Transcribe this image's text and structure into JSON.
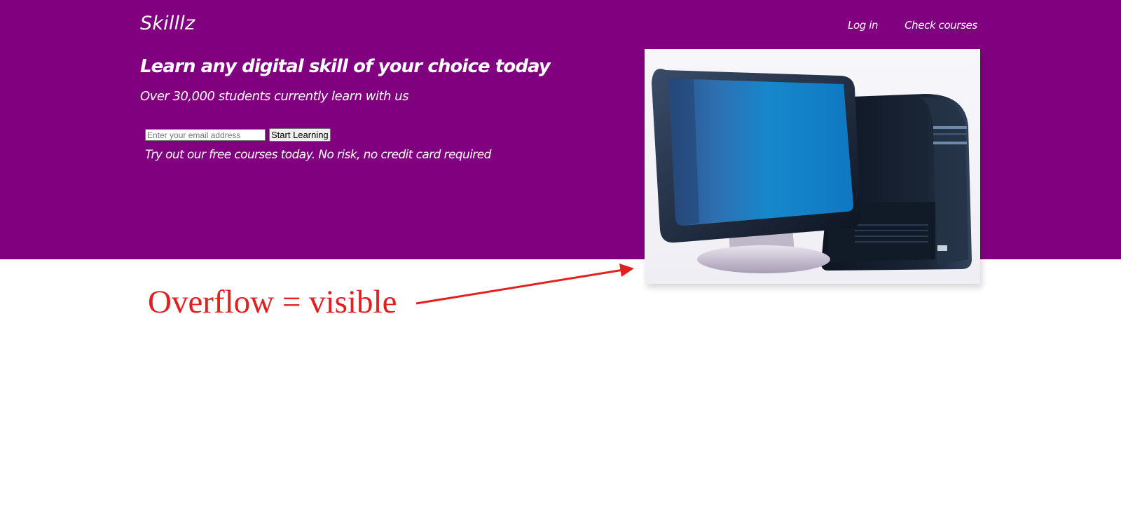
{
  "header": {
    "logo": "Skilllz",
    "nav": [
      {
        "label": "Log in"
      },
      {
        "label": "Check courses"
      }
    ]
  },
  "hero": {
    "headline": "Learn any digital skill of your choice today",
    "subheadline": "Over 30,000 students currently learn with us",
    "signup": {
      "email_placeholder": "Enter your email address",
      "email_value": "",
      "button_label": "Start Learning"
    },
    "note": "Try out our free courses today. No risk, no credit card required",
    "image": {
      "icon": "desktop-computer-icon"
    }
  },
  "annotation": {
    "text": "Overflow = visible"
  },
  "colors": {
    "hero_background": "#800080",
    "hero_text": "#ffffff",
    "annotation": "#e32020",
    "page_background": "#ffffff"
  }
}
